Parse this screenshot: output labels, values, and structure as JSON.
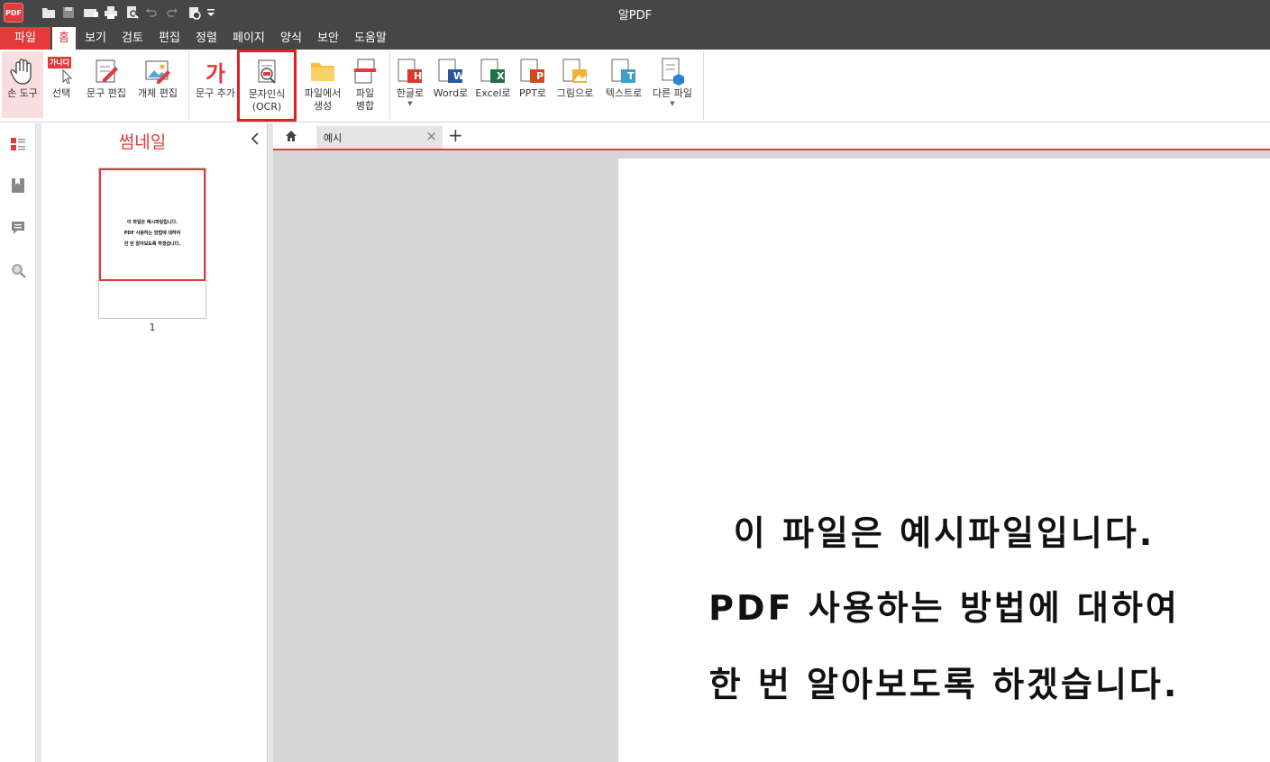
{
  "app": {
    "logo_text": "PDF",
    "title": "알PDF"
  },
  "quick_access": [
    "open-folder-icon",
    "save-icon",
    "scan-icon",
    "print-icon",
    "print-preview-icon",
    "undo-icon",
    "redo-icon",
    "customize-icon",
    "dropdown-arrow-icon"
  ],
  "menu": {
    "items": [
      "파일",
      "홈",
      "보기",
      "검토",
      "편집",
      "정렬",
      "페이지",
      "양식",
      "보안",
      "도움말"
    ],
    "active": "홈"
  },
  "ribbon": {
    "hand_tool": "손 도구",
    "select_badge": "가나다",
    "select": "선택",
    "edit_text": "문구 편집",
    "edit_object": "개체 편집",
    "add_text_icon": "가",
    "add_text": "문구 추가",
    "ocr_line1": "문자인식",
    "ocr_line2": "(OCR)",
    "create_line1": "파일에서",
    "create_line2": "생성",
    "merge_line1": "파일",
    "merge_line2": "병합",
    "to_hwp": "한글로",
    "to_word": "Word로",
    "to_excel": "Excel로",
    "to_ppt": "PPT로",
    "to_image": "그림으로",
    "to_text": "텍스트로",
    "other_file": "다른 파일",
    "badges": {
      "hwp": "H",
      "word": "W",
      "excel": "X",
      "ppt": "P",
      "text": "T",
      "pdf": "PDF"
    }
  },
  "thumbnails": {
    "title": "썸네일",
    "page_number": "1",
    "preview_lines": [
      "이 파일은 예시파일입니다.",
      "PDF 사용하는 방법에 대하여",
      "한 번 알아보도록 하겠습니다."
    ]
  },
  "tabs": {
    "doc_label": "예시",
    "close_symbol": "×",
    "add_symbol": "+"
  },
  "document": {
    "lines": [
      "이 파일은 예시파일입니다.",
      "PDF 사용하는 방법에 대하여",
      "한 번 알아보도록 하겠습니다."
    ]
  },
  "colors": {
    "accent": "#e23a3a",
    "titlebar": "#464646",
    "doc_background": "#d6d6d6"
  }
}
